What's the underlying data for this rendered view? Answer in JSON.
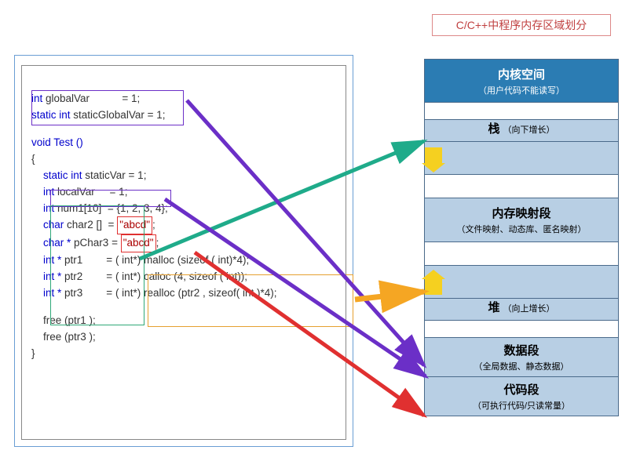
{
  "title": "C/C++中程序内存区域划分",
  "code": {
    "l1a": "int ",
    "l1b": "globalVar",
    "l1c": "           = 1;",
    "l2a": "static int ",
    "l2b": "staticGlobalVar",
    "l2c": " = 1;",
    "l3": "void Test ()",
    "l4": "{",
    "l5a": "    static int ",
    "l5b": "staticVar",
    "l5c": " = 1;",
    "l6a": "    int ",
    "l6b": "localVar",
    "l6c": "     = 1;",
    "l7a": "    int ",
    "l7b": "num1[10]",
    "l7c": "  = {1, 2, 3, 4};",
    "l8a": "    char ",
    "l8b": "char2 []",
    "l8c": "  = ",
    "l8d": "\"abcd\"",
    "l8e": ";",
    "l9a": "    char * ",
    "l9b": "pChar3",
    "l9c": " = ",
    "l9d": "\"abcd\"",
    "l9e": ";",
    "l10a": "    int * ",
    "l10b": "ptr1",
    "l10c": "        = ",
    "l10d": "( int*) malloc (sizeof ( int)*4);",
    "l11a": "    int * ",
    "l11b": "ptr2",
    "l11c": "        = ",
    "l11d": "( int*) calloc (4, sizeof ( int));",
    "l12a": "    int * ",
    "l12b": "ptr3",
    "l12c": "        = ",
    "l12d": "( int*) realloc (ptr2 , sizeof( int )*4);",
    "l13": "    free (ptr1 );",
    "l14": "    free (ptr3 );",
    "l15": "}"
  },
  "memory": {
    "kernel_title": "内核空间",
    "kernel_sub": "（用户代码不能读写）",
    "stack_title": "栈",
    "stack_sub": "（向下增长）",
    "mmap_title": "内存映射段",
    "mmap_sub": "（文件映射、动态库、匿名映射）",
    "heap_title": "堆",
    "heap_sub": "（向上增长）",
    "data_title": "数据段",
    "data_sub": "（全局数据、静态数据）",
    "code_title": "代码段",
    "code_sub": "（可执行代码/只读常量）"
  },
  "arrows": {
    "teal": "#1fab8a",
    "purple": "#6b2fc7",
    "orange": "#f5a623",
    "red": "#e03030"
  }
}
